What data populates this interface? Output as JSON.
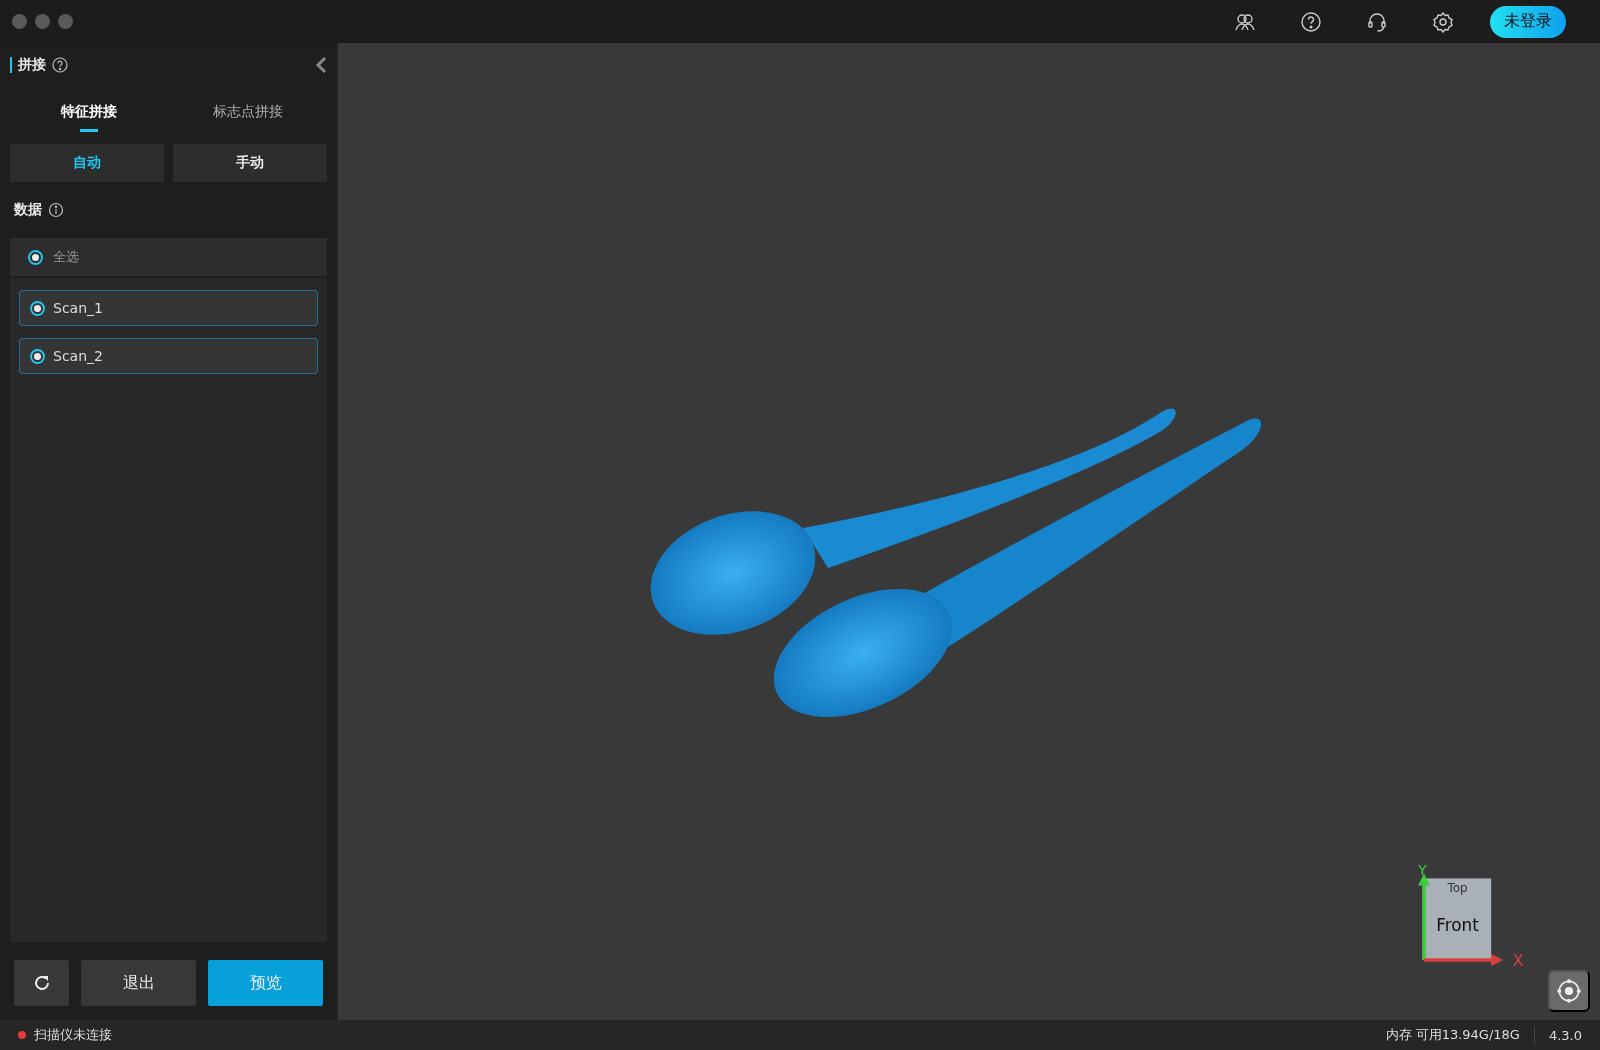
{
  "top_bar": {
    "login_button": "未登录"
  },
  "sidebar": {
    "title": "拼接",
    "tabs": [
      {
        "label": "特征拼接",
        "selected": true
      },
      {
        "label": "标志点拼接",
        "selected": false
      }
    ],
    "modes": [
      {
        "label": "自动",
        "selected": true
      },
      {
        "label": "手动",
        "selected": false
      }
    ],
    "data": {
      "title": "数据",
      "select_all": {
        "label": "全选",
        "checked": true
      },
      "scans": [
        {
          "label": "Scan_1",
          "checked": true
        },
        {
          "label": "Scan_2",
          "checked": true
        }
      ]
    },
    "actions": [
      {
        "kind": "refresh"
      },
      {
        "kind": "secondary",
        "label": "退出"
      },
      {
        "kind": "primary",
        "label": "预览"
      }
    ]
  },
  "viewport": {
    "gizmo": {
      "top": "Top",
      "front": "Front",
      "x": "X",
      "y": "Y"
    }
  },
  "status_bar": {
    "connection": "扫描仪未连接",
    "memory": "内存 可用13.94G/18G",
    "version": "4.3.0"
  }
}
